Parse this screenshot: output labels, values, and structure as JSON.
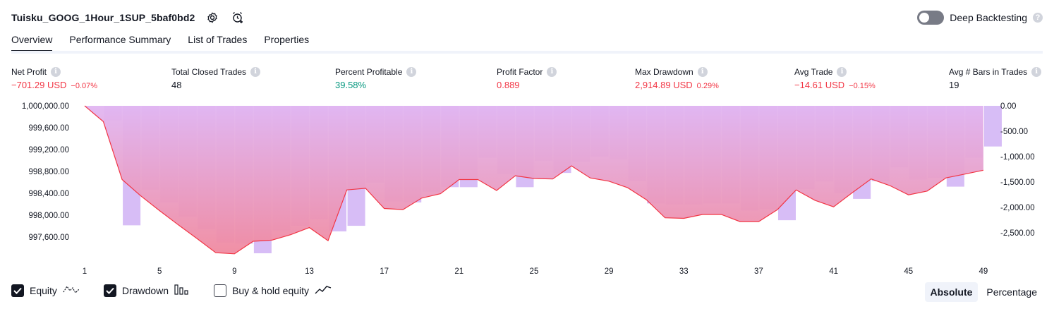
{
  "header": {
    "strategy_name": "Tuisku_GOOG_1Hour_1SUP_5baf0bd2",
    "settings_icon": "gear-icon",
    "alert_icon": "alarm-add-icon",
    "deep_backtesting_label": "Deep Backtesting",
    "deep_backtesting_on": false,
    "help_glyph": "?"
  },
  "tabs": [
    {
      "label": "Overview",
      "active": true
    },
    {
      "label": "Performance Summary",
      "active": false
    },
    {
      "label": "List of Trades",
      "active": false
    },
    {
      "label": "Properties",
      "active": false
    }
  ],
  "metrics": [
    {
      "label": "Net Profit",
      "value": "−701.29 USD",
      "pct": "−0.07%",
      "tone": "neg"
    },
    {
      "label": "Total Closed Trades",
      "value": "48",
      "pct": "",
      "tone": "plain"
    },
    {
      "label": "Percent Profitable",
      "value": "39.58%",
      "pct": "",
      "tone": "pos"
    },
    {
      "label": "Profit Factor",
      "value": "0.889",
      "pct": "",
      "tone": "neg"
    },
    {
      "label": "Max Drawdown",
      "value": "2,914.89 USD",
      "pct": "0.29%",
      "tone": "neg"
    },
    {
      "label": "Avg Trade",
      "value": "−14.61 USD",
      "pct": "−0.15%",
      "tone": "neg"
    },
    {
      "label": "Avg # Bars in Trades",
      "value": "19",
      "pct": "",
      "tone": "plain"
    }
  ],
  "info_glyph": "i",
  "chart_data": {
    "type": "line",
    "title": "",
    "equity": {
      "name": "Equity",
      "color": "#f23645",
      "x": [
        1,
        2,
        3,
        4,
        5,
        6,
        7,
        8,
        9,
        10,
        11,
        12,
        13,
        14,
        15,
        16,
        17,
        18,
        19,
        20,
        21,
        22,
        23,
        24,
        25,
        26,
        27,
        28,
        29,
        30,
        31,
        32,
        33,
        34,
        35,
        36,
        37,
        38,
        39,
        40,
        41,
        42,
        43,
        44,
        45,
        46,
        47,
        48,
        49
      ],
      "values": [
        1000000,
        999710,
        998650,
        998350,
        998080,
        997820,
        997570,
        997310,
        997290,
        997520,
        997540,
        997640,
        997770,
        997530,
        998460,
        998490,
        998120,
        998100,
        998310,
        998390,
        998650,
        998650,
        998450,
        998720,
        998670,
        998660,
        998900,
        998680,
        998620,
        998500,
        998280,
        997950,
        997940,
        998010,
        998010,
        997880,
        997880,
        998100,
        998460,
        998270,
        998150,
        998410,
        998660,
        998540,
        998370,
        998440,
        998680,
        998750,
        998820
      ]
    },
    "drawdown": {
      "name": "Drawdown",
      "color": "#b39ddb",
      "x": [
        1,
        2,
        3,
        4,
        5,
        6,
        7,
        8,
        9,
        10,
        11,
        12,
        13,
        14,
        15,
        16,
        17,
        18,
        19,
        20,
        21,
        22,
        23,
        24,
        25,
        26,
        27,
        28,
        29,
        30,
        31,
        32,
        33,
        34,
        35,
        36,
        37,
        38,
        39,
        40,
        41,
        42,
        43,
        44,
        45,
        46,
        47,
        48,
        49
      ],
      "values": [
        0,
        -290,
        -2350,
        -1650,
        -1900,
        -2180,
        -2430,
        -2690,
        -2710,
        -2900,
        -2450,
        -2360,
        -2230,
        -2470,
        -2360,
        -1510,
        -1880,
        -1900,
        -1690,
        -1600,
        -1600,
        -1020,
        -1340,
        -1600,
        -1080,
        -1320,
        -1100,
        -1000,
        -1050,
        -1480,
        -1920,
        -1940,
        -1940,
        -1920,
        -1920,
        -2060,
        -2030,
        -2250,
        -1640,
        -1490,
        -1720,
        -1830,
        -1480,
        -1210,
        -1450,
        -1420,
        -1590,
        -1020,
        -800
      ]
    },
    "buy_hold": {
      "name": "Buy & hold equity",
      "visible": false
    },
    "x_ticks": [
      1,
      5,
      9,
      13,
      17,
      21,
      25,
      29,
      33,
      37,
      41,
      45,
      49
    ],
    "left_axis": {
      "min": 997300,
      "max": 1000000,
      "ticks": [
        "1,000,000.00",
        "999,600.00",
        "999,200.00",
        "998,800.00",
        "998,400.00",
        "998,000.00",
        "997,600.00"
      ]
    },
    "right_axis": {
      "min": -2900,
      "max": 0,
      "ticks": [
        "0.00",
        "-500.00",
        "-1,000.00",
        "-1,500.00",
        "-2,000.00",
        "-2,500.00"
      ]
    },
    "grid": false
  },
  "legend": [
    {
      "label": "Equity",
      "checked": true,
      "icon": "equity-line-icon"
    },
    {
      "label": "Drawdown",
      "checked": true,
      "icon": "drawdown-bars-icon"
    },
    {
      "label": "Buy & hold equity",
      "checked": false,
      "icon": "buy-hold-line-icon"
    }
  ],
  "scale_toggle": [
    {
      "label": "Absolute",
      "active": true
    },
    {
      "label": "Percentage",
      "active": false
    }
  ]
}
